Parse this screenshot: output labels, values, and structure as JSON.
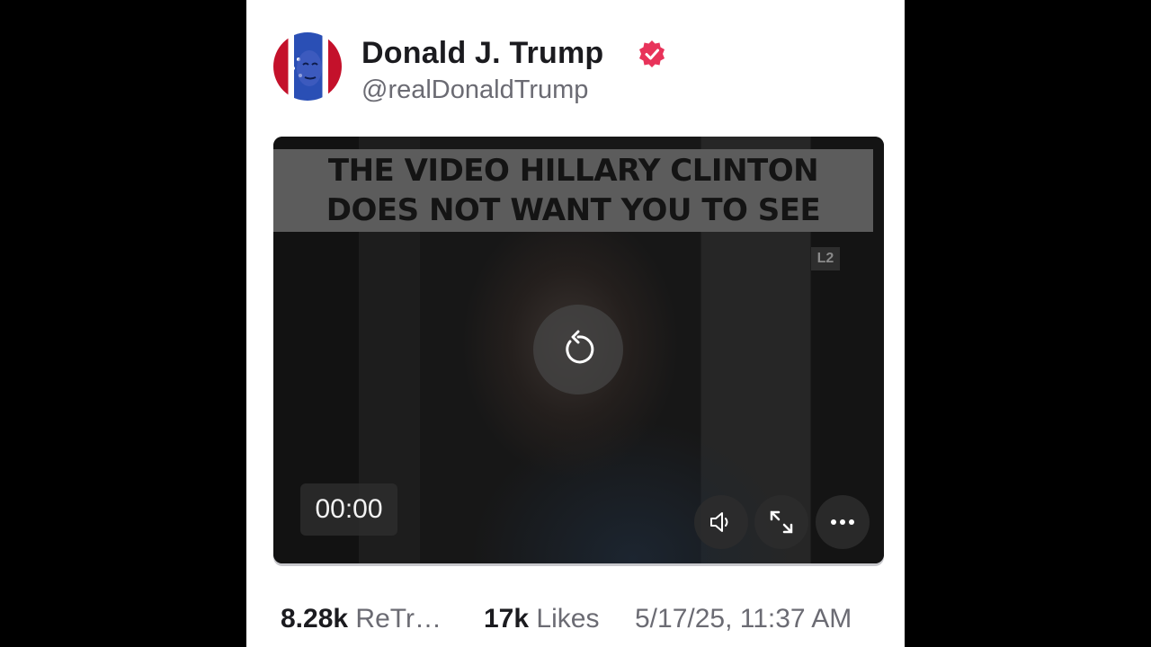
{
  "post": {
    "author_name": "Donald J. Trump",
    "author_handle": "@realDonaldTrump",
    "verified_icon": "verified-badge-icon",
    "avatar_icon": "avatar-flag-portrait"
  },
  "video": {
    "banner_line1": "THE VIDEO HILLARY CLINTON",
    "banner_line2": "DOES NOT WANT YOU TO SEE",
    "corner_logo": "L2",
    "time": "00:00",
    "replay_icon": "replay-icon",
    "volume_icon": "volume-icon",
    "fullscreen_icon": "fullscreen-icon",
    "more_icon": "more-options-icon"
  },
  "stats": {
    "retruths_count": "8.28k",
    "retruths_label": "ReTr…",
    "likes_count": "17k",
    "likes_label": "Likes",
    "timestamp": "5/17/25, 11:37 AM"
  },
  "colors": {
    "verified": "#e8335a",
    "name": "#1b1b1f",
    "muted": "#6b6b73",
    "outer_background": "#000000"
  }
}
